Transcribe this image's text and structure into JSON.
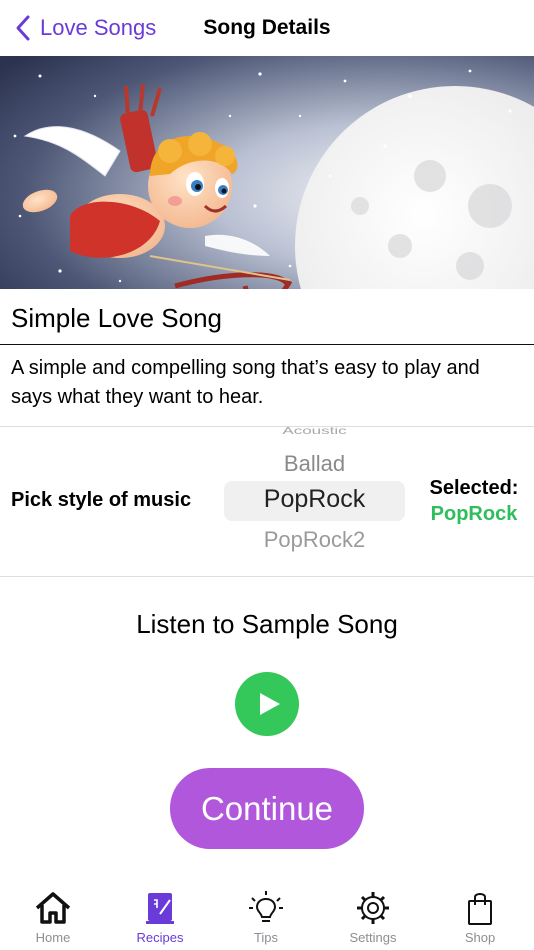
{
  "nav": {
    "back_label": "Love Songs",
    "title": "Song Details"
  },
  "song": {
    "title": "Simple Love Song",
    "description": "A simple and compelling song that’s easy to play and says what they want to hear."
  },
  "picker": {
    "label": "Pick style of music",
    "options": [
      "Acoustic",
      "Ballad",
      "PopRock",
      "PopRock2"
    ],
    "selected_label": "Selected:",
    "selected_value": "PopRock"
  },
  "sample": {
    "label": "Listen to Sample Song"
  },
  "continue_label": "Continue",
  "tabs": [
    {
      "label": "Home",
      "icon": "house-icon"
    },
    {
      "label": "Recipes",
      "icon": "recipe-book-icon",
      "active": true
    },
    {
      "label": "Tips",
      "icon": "lightbulb-icon"
    },
    {
      "label": "Settings",
      "icon": "gear-icon"
    },
    {
      "label": "Shop",
      "icon": "shopping-bag-icon"
    }
  ],
  "colors": {
    "accent": "#6a3bd8",
    "play": "#34c759",
    "selected": "#2fbe5c",
    "continue": "#b057dc"
  }
}
